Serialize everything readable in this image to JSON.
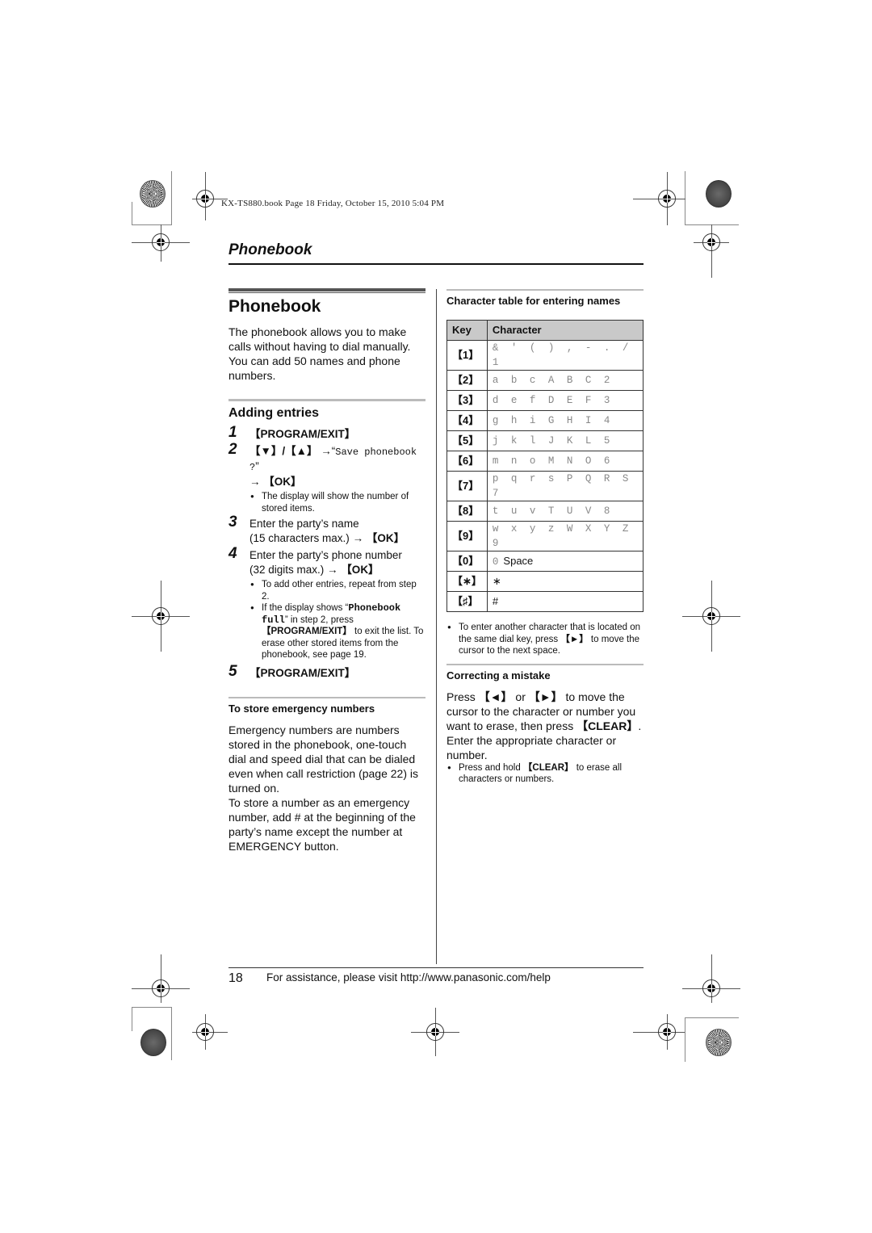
{
  "print_header": "KX-TS880.book  Page 18  Friday, October 15, 2010  5:04 PM",
  "section_title": "Phonebook",
  "left": {
    "heading": "Phonebook",
    "intro": "The phonebook allows you to make calls without having to dial manually. You can add 50 names and phone numbers.",
    "subheading": "Adding entries",
    "steps": [
      {
        "num": "1",
        "key": "【PROGRAM/EXIT】"
      },
      {
        "num": "2",
        "keys": "【▼】/【▲】",
        "arrow": "→",
        "quote_open": "“",
        "display": "Save phonebook ?",
        "quote_close": "”",
        "arrow2": "→",
        "ok": "【OK】",
        "bullets": [
          "The display will show the number of stored items."
        ]
      },
      {
        "num": "3",
        "line1": "Enter the party’s name",
        "line2": "(15 characters max.)",
        "arrow": "→",
        "ok": "【OK】"
      },
      {
        "num": "4",
        "line1": "Enter the party’s phone number",
        "line2": "(32 digits max.)",
        "arrow": "→",
        "ok": "【OK】",
        "bullets": [
          "To add other entries, repeat from step 2.",
          {
            "pre": "If the display shows “",
            "display": "Phonebook full",
            "mid": "” in step 2, press ",
            "key": "【PROGRAM/EXIT】",
            "post": " to exit the list. To erase other stored items from the phonebook, see page 19."
          }
        ]
      },
      {
        "num": "5",
        "key": "【PROGRAM/EXIT】"
      }
    ],
    "emergency_heading": "To store emergency numbers",
    "emergency_p1": "Emergency numbers are numbers stored in the phonebook, one-touch dial and speed dial that can be dialed even when call restriction (page 22) is turned on.",
    "emergency_p2": "To store a number as an emergency number, add # at the beginning of the party’s name except the number at EMERGENCY button."
  },
  "right": {
    "table_heading": "Character table for entering names",
    "table_headers": [
      "Key",
      "Character"
    ],
    "table_rows": [
      {
        "key": "【1】",
        "chars": "& ' ( ) , - . / 1"
      },
      {
        "key": "【2】",
        "chars": "a b c A B C 2"
      },
      {
        "key": "【3】",
        "chars": "d e f D E F 3"
      },
      {
        "key": "【4】",
        "chars": "g h i G H I 4"
      },
      {
        "key": "【5】",
        "chars": "j k l J K L 5"
      },
      {
        "key": "【6】",
        "chars": "m n o M N O 6"
      },
      {
        "key": "【7】",
        "chars": "p q r s P Q R S 7"
      },
      {
        "key": "【8】",
        "chars": "t u v T U V 8"
      },
      {
        "key": "【9】",
        "chars": "w x y z W X Y Z 9"
      },
      {
        "key": "【0】",
        "chars": "0",
        "extra": "Space"
      },
      {
        "key": "【∗】",
        "chars": "",
        "extra": "∗"
      },
      {
        "key": "【♯】",
        "chars": "",
        "extra": "#"
      }
    ],
    "table_note": {
      "pre": "To enter another character that is located on the same dial key, press ",
      "key": "【►】",
      "post": " to move the cursor to the next space."
    },
    "correcting_heading": "Correcting a mistake",
    "correcting_text": {
      "pre": "Press ",
      "key1": "【◄】",
      "mid1": " or ",
      "key2": "【►】",
      "mid2": " to move the cursor to the character or number you want to erase, then press ",
      "key3": "【CLEAR】",
      "post": ". Enter the appropriate character or number."
    },
    "correcting_bullet": {
      "pre": "Press and hold ",
      "key": "【CLEAR】",
      "post": " to erase all characters or numbers."
    }
  },
  "footer": {
    "page_number": "18",
    "text": "For assistance, please visit http://www.panasonic.com/help"
  }
}
